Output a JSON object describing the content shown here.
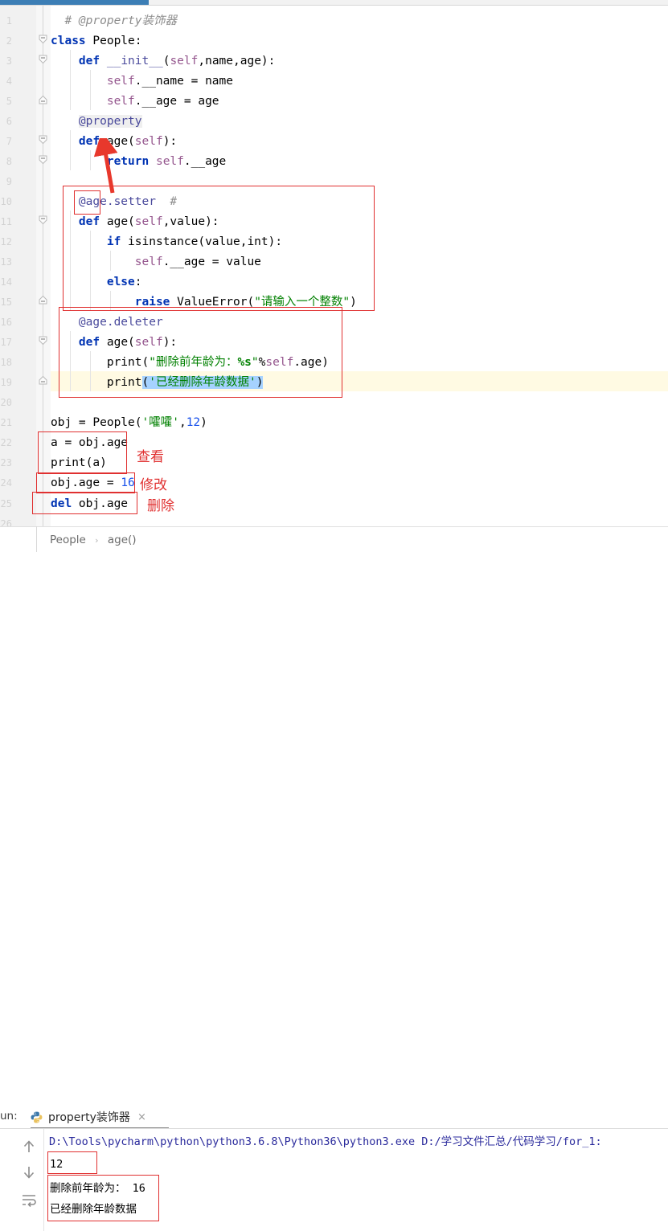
{
  "app": {
    "type": "pycharm-ide",
    "accent": "#3c7eb5",
    "annotation_color": "#e03030",
    "caret_line_color": "#fffae3",
    "selection_color": "#a6d2ff"
  },
  "editor": {
    "line_numbers": [
      "1",
      "2",
      "3",
      "4",
      "5",
      "6",
      "7",
      "8",
      "9",
      "10",
      "11",
      "12",
      "13",
      "14",
      "15",
      "16",
      "17",
      "18",
      "19",
      "20",
      "21",
      "22",
      "23",
      "24",
      "25",
      "26"
    ],
    "lines": [
      "# @property装饰器",
      "class People:",
      "    def __init__(self,name,age):",
      "        self.__name = name",
      "        self.__age = age",
      "    @property",
      "    def age(self):",
      "        return self.__age",
      "",
      "    @age.setter  #",
      "    def age(self,value):",
      "        if isinstance(value,int):",
      "            self.__age = value",
      "        else:",
      "            raise ValueError(\"请输入一个整数\")",
      "    @age.deleter",
      "    def age(self):",
      "        print(\"删除前年龄为：%s\"%self.age)",
      "        print('已经删除年龄数据')",
      "",
      "obj = People('嚯嚯',12)",
      "a = obj.age",
      "print(a)",
      "obj.age = 16",
      "del obj.age"
    ],
    "strings": {
      "value_error_msg": "请输入一个整数",
      "print_age_msg": "删除前年龄为：%s",
      "print_deleted_msg": "已经删除年龄数据",
      "people_name": "嚯嚯",
      "people_age": "12",
      "new_age": "16"
    }
  },
  "annotations": {
    "view_label": "查看",
    "modify_label": "修改",
    "delete_label": "删除"
  },
  "breadcrumb": {
    "class_name": "People",
    "separator": "›",
    "method_name": "age()"
  },
  "run_panel": {
    "label": "un:",
    "tab_title": "property装饰器",
    "close": "×",
    "toolbar": {
      "up": "scroll-up-icon",
      "down": "scroll-down-icon",
      "wrap": "soft-wrap-icon"
    },
    "output": [
      "D:\\Tools\\pycharm\\python\\python3.6.8\\Python36\\python3.exe D:/学习文件汇总/代码学习/for_1:",
      "12",
      "删除前年龄为： 16",
      "已经删除年龄数据"
    ]
  }
}
